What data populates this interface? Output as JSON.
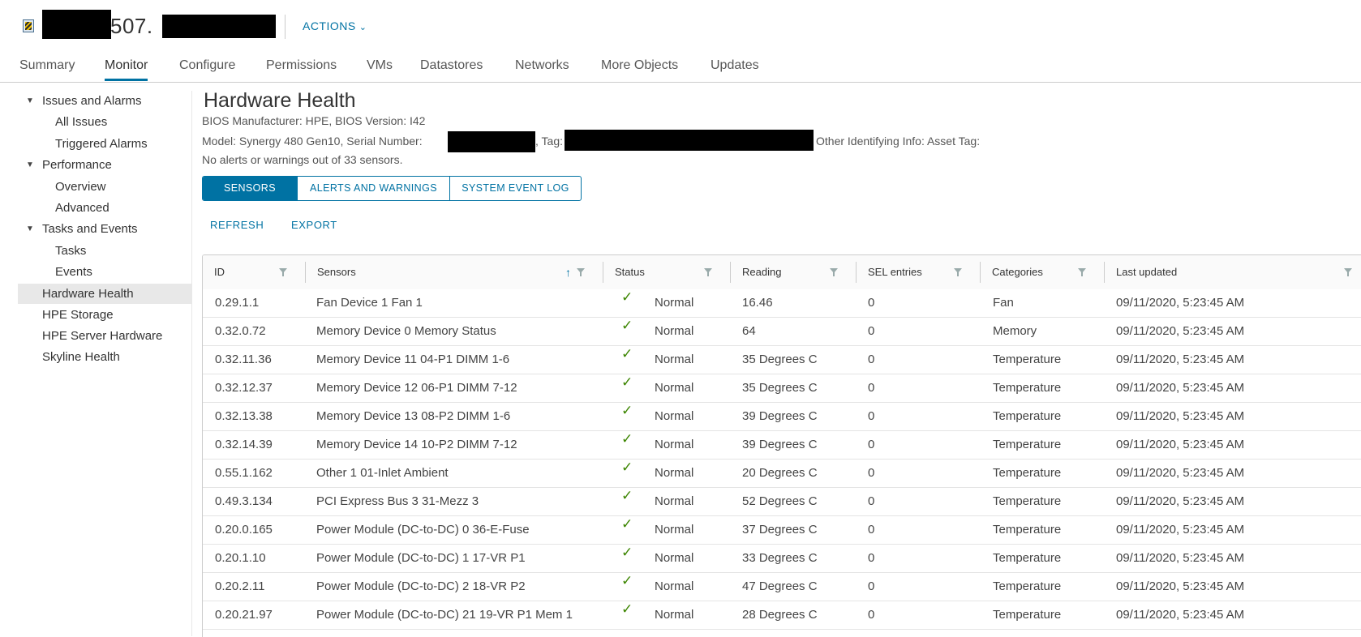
{
  "header": {
    "title": "507.",
    "actions_label": "ACTIONS",
    "actions_icon": "chevron-down-icon"
  },
  "tabs": [
    {
      "label": "Summary"
    },
    {
      "label": "Monitor"
    },
    {
      "label": "Configure"
    },
    {
      "label": "Permissions"
    },
    {
      "label": "VMs"
    },
    {
      "label": "Datastores"
    },
    {
      "label": "Networks"
    },
    {
      "label": "More Objects"
    },
    {
      "label": "Updates"
    }
  ],
  "active_tab": "Monitor",
  "sidebar": {
    "issues_group": "Issues and Alarms",
    "all_issues": "All Issues",
    "triggered_alarms": "Triggered Alarms",
    "performance_group": "Performance",
    "overview": "Overview",
    "advanced": "Advanced",
    "tasks_group": "Tasks and Events",
    "tasks": "Tasks",
    "events": "Events",
    "hardware_health": "Hardware Health",
    "hpe_storage": "HPE Storage",
    "hpe_server_hardware": "HPE Server Hardware",
    "skyline_health": "Skyline Health"
  },
  "main": {
    "title": "Hardware Health",
    "bios_line": "BIOS Manufacturer: HPE, BIOS Version: I42",
    "model_prefix": "Model: Synergy 480 Gen10, Serial Number:",
    "tag_label": ", Tag:",
    "other_info": "Other Identifying Info: Asset Tag:",
    "alerts_summary": "No alerts or warnings out of 33 sensors.",
    "segments": [
      "SENSORS",
      "ALERTS AND WARNINGS",
      "SYSTEM EVENT LOG"
    ],
    "refresh": "REFRESH",
    "export": "EXPORT"
  },
  "grid": {
    "columns": [
      "ID",
      "Sensors",
      "Status",
      "Reading",
      "SEL entries",
      "Categories",
      "Last updated"
    ],
    "rows": [
      [
        "0.29.1.1",
        "Fan Device 1 Fan 1",
        "Normal",
        "16.46",
        "0",
        "Fan",
        "09/11/2020, 5:23:45 AM"
      ],
      [
        "0.32.0.72",
        "Memory Device 0 Memory Status",
        "Normal",
        "64",
        "0",
        "Memory",
        "09/11/2020, 5:23:45 AM"
      ],
      [
        "0.32.11.36",
        "Memory Device 11 04-P1 DIMM 1-6",
        "Normal",
        "35 Degrees C",
        "0",
        "Temperature",
        "09/11/2020, 5:23:45 AM"
      ],
      [
        "0.32.12.37",
        "Memory Device 12 06-P1 DIMM 7-12",
        "Normal",
        "35 Degrees C",
        "0",
        "Temperature",
        "09/11/2020, 5:23:45 AM"
      ],
      [
        "0.32.13.38",
        "Memory Device 13 08-P2 DIMM 1-6",
        "Normal",
        "39 Degrees C",
        "0",
        "Temperature",
        "09/11/2020, 5:23:45 AM"
      ],
      [
        "0.32.14.39",
        "Memory Device 14 10-P2 DIMM 7-12",
        "Normal",
        "39 Degrees C",
        "0",
        "Temperature",
        "09/11/2020, 5:23:45 AM"
      ],
      [
        "0.55.1.162",
        "Other 1 01-Inlet Ambient",
        "Normal",
        "20 Degrees C",
        "0",
        "Temperature",
        "09/11/2020, 5:23:45 AM"
      ],
      [
        "0.49.3.134",
        "PCI Express Bus 3 31-Mezz 3",
        "Normal",
        "52 Degrees C",
        "0",
        "Temperature",
        "09/11/2020, 5:23:45 AM"
      ],
      [
        "0.20.0.165",
        "Power Module (DC-to-DC) 0 36-E-Fuse",
        "Normal",
        "37 Degrees C",
        "0",
        "Temperature",
        "09/11/2020, 5:23:45 AM"
      ],
      [
        "0.20.1.10",
        "Power Module (DC-to-DC) 1 17-VR P1",
        "Normal",
        "33 Degrees C",
        "0",
        "Temperature",
        "09/11/2020, 5:23:45 AM"
      ],
      [
        "0.20.2.11",
        "Power Module (DC-to-DC) 2 18-VR P2",
        "Normal",
        "47 Degrees C",
        "0",
        "Temperature",
        "09/11/2020, 5:23:45 AM"
      ],
      [
        "0.20.21.97",
        "Power Module (DC-to-DC) 21 19-VR P1 Mem 1",
        "Normal",
        "28 Degrees C",
        "0",
        "Temperature",
        "09/11/2020, 5:23:45 AM"
      ]
    ]
  },
  "colors": {
    "accent": "#0072a3",
    "ok_check": "#3c8500",
    "selected_bg": "#e8e8e8"
  }
}
